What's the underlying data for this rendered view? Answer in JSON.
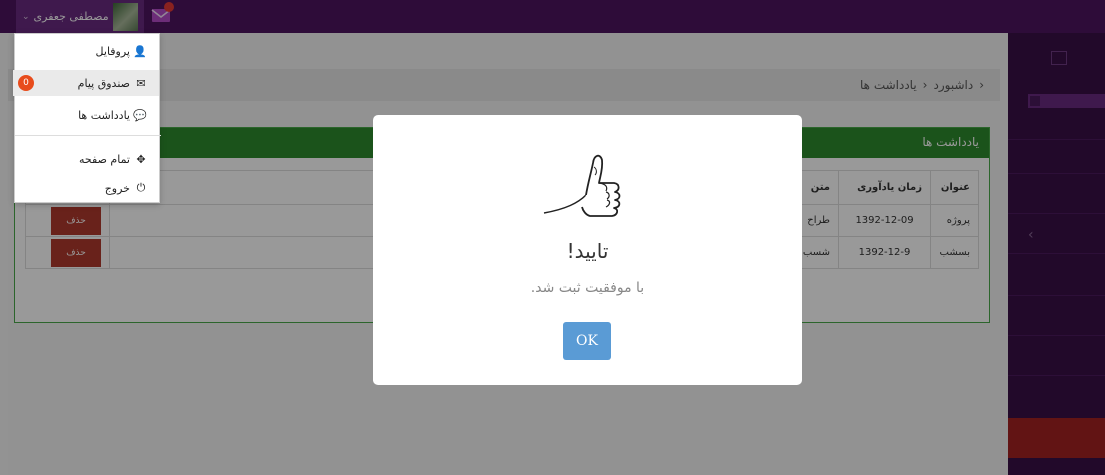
{
  "topbar": {
    "user_name": "مصطفی جعفری",
    "caret": "⌄",
    "mail_icon": "envelope-icon",
    "colors": {
      "bar": "#4e1560",
      "chip": "#6a2a80"
    }
  },
  "dropdown": {
    "items": [
      {
        "label": "پروفایل",
        "icon": "user-icon",
        "glyph": "👤"
      },
      {
        "label": "صندوق پیام",
        "icon": "envelope-icon",
        "glyph": "✉",
        "badge": "0"
      },
      {
        "label": "یادداشت ها",
        "icon": "comment-icon",
        "glyph": "💬"
      },
      {
        "label": "تمام صفحه",
        "icon": "move-icon",
        "glyph": "✥"
      },
      {
        "label": "خروج",
        "icon": "power-icon",
        "glyph": "⏻"
      }
    ]
  },
  "breadcrumb": {
    "chevron": "‹",
    "items": [
      "داشبورد",
      "یادداشت ها"
    ]
  },
  "panel": {
    "title": "یادداشت ها",
    "color": "#2e8b2e",
    "columns": [
      "عنوان",
      "زمان یادآوری",
      "متن"
    ],
    "rows": [
      {
        "title": "پروژه",
        "date": "1392-12-09",
        "text": "طراح",
        "delete_label": "حذف"
      },
      {
        "title": "بسشب",
        "date": "1392-12-9",
        "text": "شسب",
        "delete_label": "حذف"
      }
    ]
  },
  "modal": {
    "icon": "thumbs-up-icon",
    "title": "تایید!",
    "text": "با موفقیت ثبت شد.",
    "ok_label": "OK",
    "ok_color": "#5a9bd5"
  },
  "sidebar": {
    "chevron": "‹",
    "accent": "#a32222"
  }
}
